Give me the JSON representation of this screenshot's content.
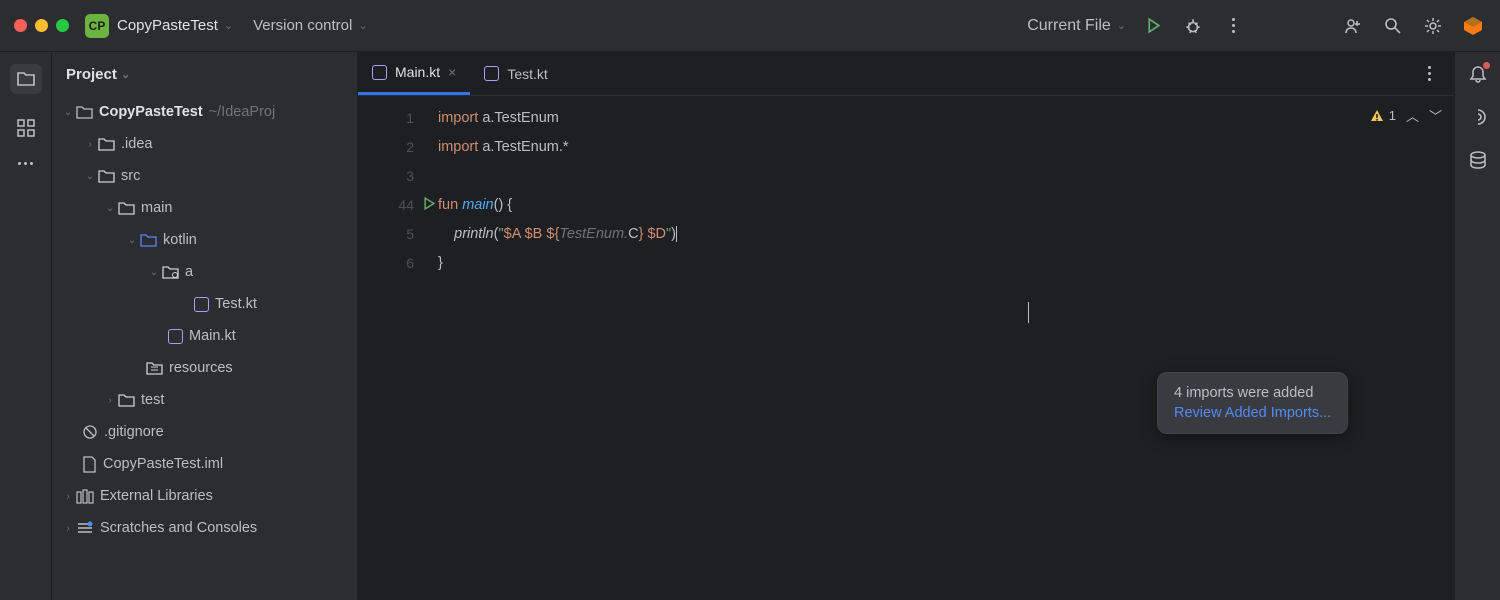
{
  "titlebar": {
    "badge": "CP",
    "project": "CopyPasteTest",
    "vc": "Version control",
    "runconfig": "Current File"
  },
  "panel": {
    "title": "Project"
  },
  "tree": {
    "root": "CopyPasteTest",
    "root_path": "~/IdeaProj",
    "n1": ".idea",
    "n2": "src",
    "n3": "main",
    "n4": "kotlin",
    "n5": "a",
    "n6": "Test.kt",
    "n7": "Main.kt",
    "n8": "resources",
    "n9": "test",
    "n10": ".gitignore",
    "n11": "CopyPasteTest.iml",
    "n12": "External Libraries",
    "n13": "Scratches and Consoles"
  },
  "tabs": {
    "t0": "Main.kt",
    "t1": "Test.kt"
  },
  "code": {
    "l1a": "import",
    "l1b": " a.TestEnum",
    "l2a": "import",
    "l2b": " a.TestEnum.*",
    "l4a": "fun ",
    "l4b": "main",
    "l4c": "() {",
    "l5a": "println",
    "l5b": "(",
    "l5c": "\"",
    "l5d": "$A",
    "l5e": " ",
    "l5f": "$B",
    "l5g": " ",
    "l5h": "${",
    "l5i": "TestEnum.",
    "l5j": "C",
    "l5k": "}",
    "l5l": " ",
    "l5m": "$D",
    "l5n": "\"",
    "l5o": ")",
    "l6": "}"
  },
  "gutter": [
    "1",
    "2",
    "3",
    "4",
    "5",
    "6"
  ],
  "inspection": {
    "warn_count": "1"
  },
  "popup": {
    "msg": "4 imports were added",
    "link": "Review Added Imports..."
  }
}
